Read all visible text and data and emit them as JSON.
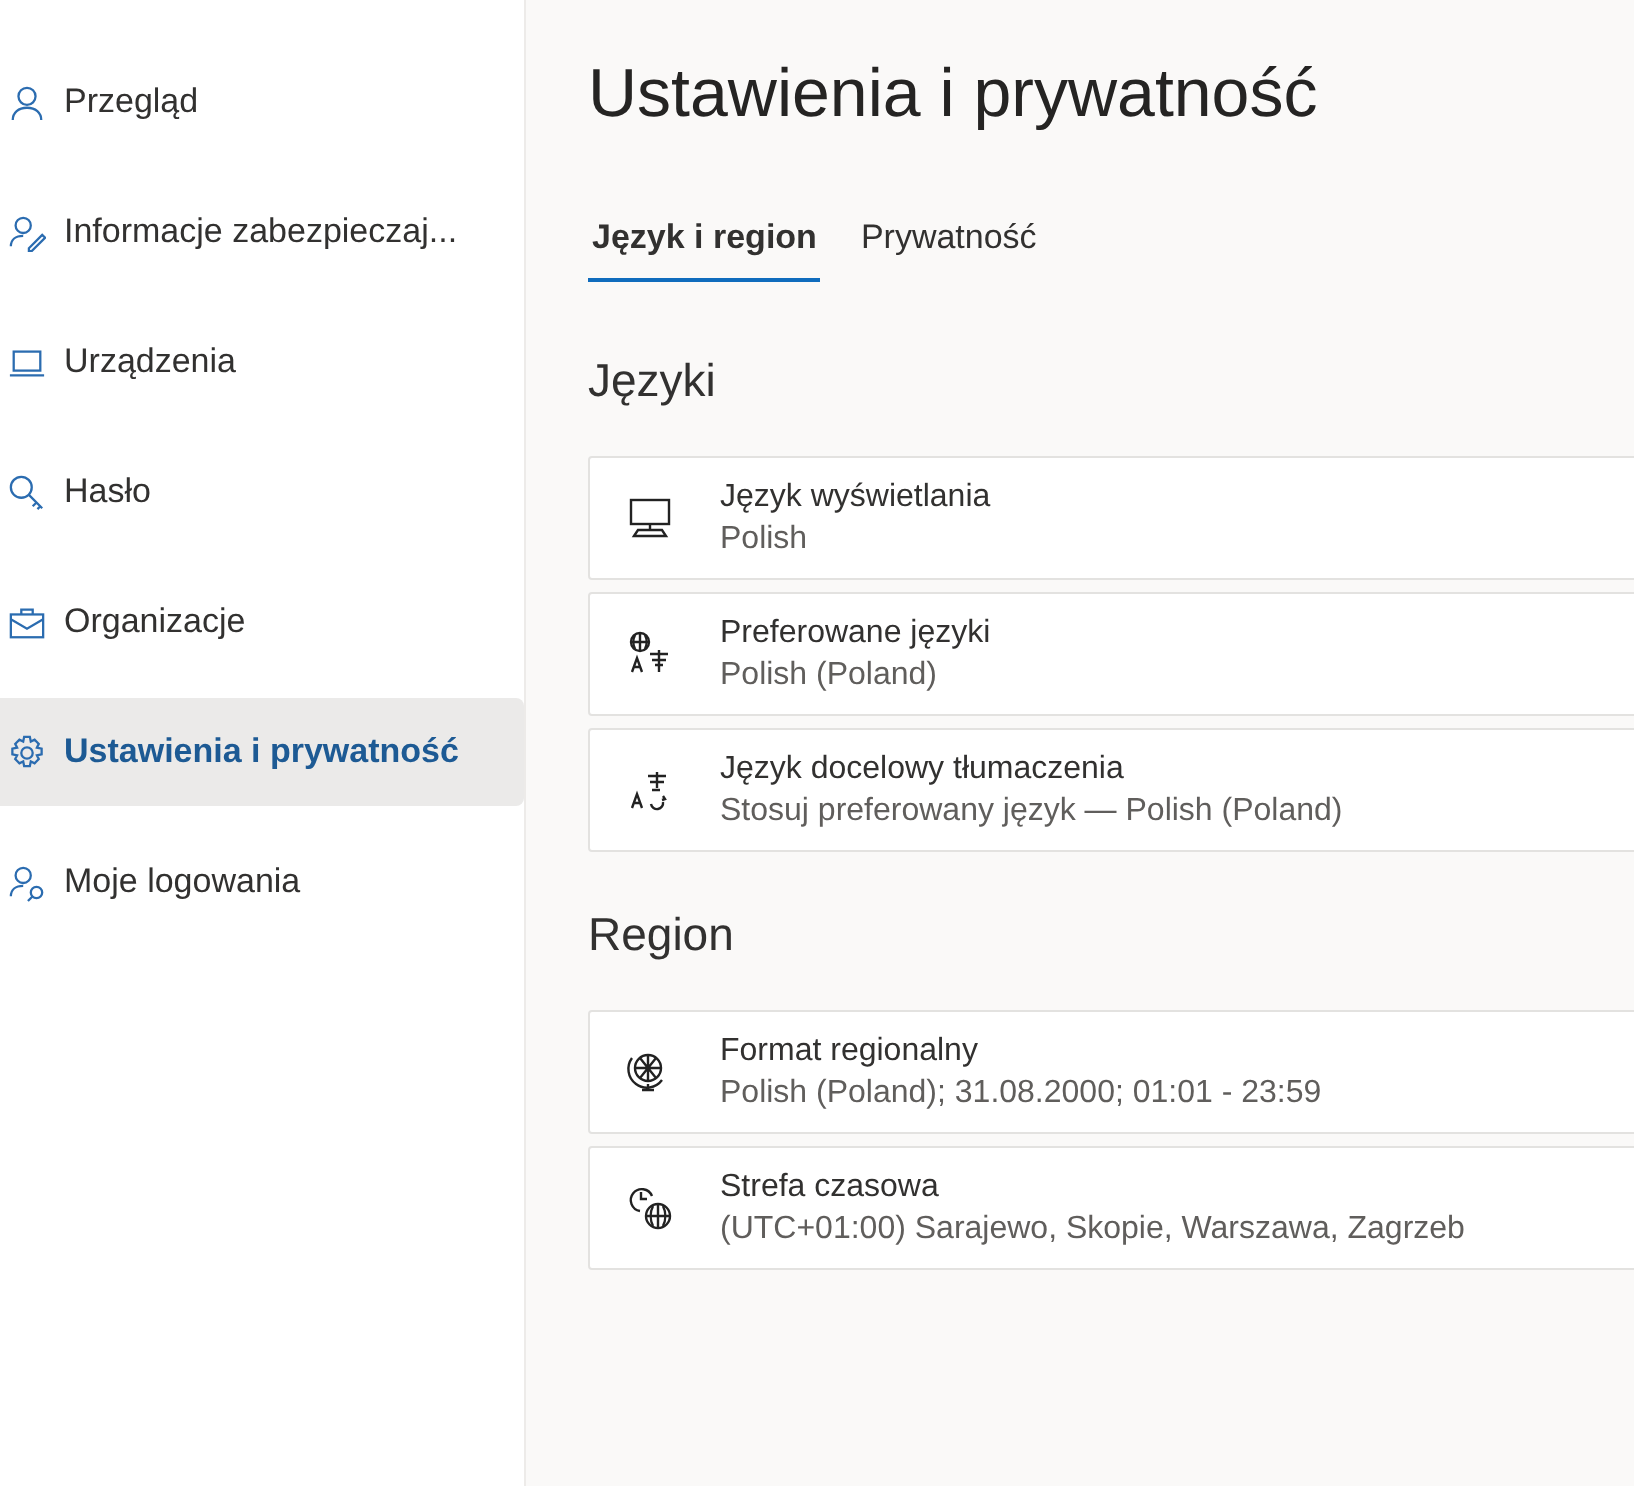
{
  "sidebar": {
    "items": [
      {
        "label": "Przegląd",
        "selected": false
      },
      {
        "label": "Informacje zabezpieczaj...",
        "selected": false
      },
      {
        "label": "Urządzenia",
        "selected": false
      },
      {
        "label": "Hasło",
        "selected": false
      },
      {
        "label": "Organizacje",
        "selected": false
      },
      {
        "label": "Ustawienia i prywatność",
        "selected": true
      },
      {
        "label": "Moje logowania",
        "selected": false
      }
    ]
  },
  "page": {
    "title": "Ustawienia i prywatność",
    "tabs": [
      {
        "label": "Język i region",
        "selected": true
      },
      {
        "label": "Prywatność",
        "selected": false
      }
    ],
    "sections": [
      {
        "heading": "Języki",
        "items": [
          {
            "title": "Język wyświetlania",
            "value": "Polish"
          },
          {
            "title": "Preferowane języki",
            "value": "Polish (Poland)"
          },
          {
            "title": "Język docelowy tłumaczenia",
            "value": "Stosuj preferowany język — Polish (Poland)"
          }
        ]
      },
      {
        "heading": "Region",
        "items": [
          {
            "title": "Format regionalny",
            "value": "Polish (Poland); 31.08.2000; 01:01 - 23:59"
          },
          {
            "title": "Strefa czasowa",
            "value": "(UTC+01:00) Sarajewo, Skopie, Warszawa, Zagrzeb"
          }
        ]
      }
    ]
  }
}
